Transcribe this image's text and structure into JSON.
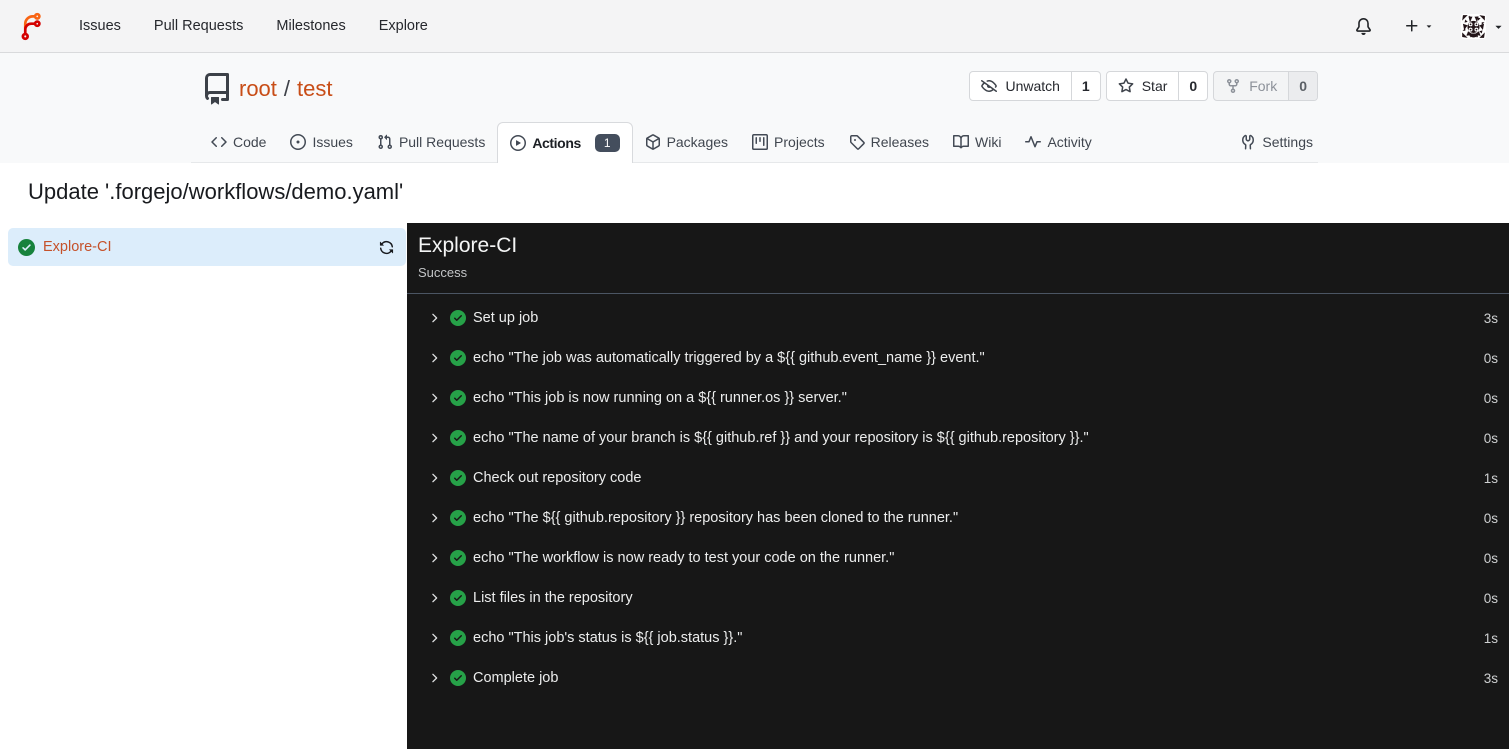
{
  "navbar": {
    "logo": "forgejo-logo",
    "links": [
      {
        "label": "Issues"
      },
      {
        "label": "Pull Requests"
      },
      {
        "label": "Milestones"
      },
      {
        "label": "Explore"
      }
    ],
    "icons": {
      "bell": "bell-icon",
      "plus": "plus-icon",
      "caret": "caret-down-icon",
      "avatar": "user-avatar-identicon"
    }
  },
  "repo_header": {
    "owner": "root",
    "separator": "/",
    "name": "test",
    "buttons": [
      {
        "label": "Unwatch",
        "count": "1",
        "icon": "eye-closed-icon",
        "disabled": false
      },
      {
        "label": "Star",
        "count": "0",
        "icon": "star-icon",
        "disabled": false
      },
      {
        "label": "Fork",
        "count": "0",
        "icon": "repo-forked-icon",
        "disabled": true
      }
    ],
    "tabs": [
      {
        "label": "Code",
        "icon": "code",
        "active": false
      },
      {
        "label": "Issues",
        "icon": "issue",
        "active": false
      },
      {
        "label": "Pull Requests",
        "icon": "pr",
        "active": false
      },
      {
        "label": "Actions",
        "icon": "play",
        "active": true,
        "badge": "1"
      },
      {
        "label": "Packages",
        "icon": "package",
        "active": false
      },
      {
        "label": "Projects",
        "icon": "project",
        "active": false
      },
      {
        "label": "Releases",
        "icon": "tag",
        "active": false
      },
      {
        "label": "Wiki",
        "icon": "book",
        "active": false
      },
      {
        "label": "Activity",
        "icon": "pulse",
        "active": false
      }
    ],
    "settings_tab": {
      "label": "Settings",
      "icon": "tools"
    }
  },
  "run": {
    "title": "Update '.forgejo/workflows/demo.yaml'",
    "jobs": [
      {
        "name": "Explore-CI",
        "status": "success"
      }
    ],
    "panel": {
      "job_name": "Explore-CI",
      "status_text": "Success",
      "steps": [
        {
          "name": "Set up job",
          "duration": "3s"
        },
        {
          "name": "echo \"The job was automatically triggered by a ${{ github.event_name }} event.\"",
          "duration": "0s"
        },
        {
          "name": "echo \"This job is now running on a ${{ runner.os }} server.\"",
          "duration": "0s"
        },
        {
          "name": "echo \"The name of your branch is ${{ github.ref }} and your repository is ${{ github.repository }}.\"",
          "duration": "0s"
        },
        {
          "name": "Check out repository code",
          "duration": "1s"
        },
        {
          "name": "echo \"The ${{ github.repository }} repository has been cloned to the runner.\"",
          "duration": "0s"
        },
        {
          "name": "echo \"The workflow is now ready to test your code on the runner.\"",
          "duration": "0s"
        },
        {
          "name": "List files in the repository",
          "duration": "0s"
        },
        {
          "name": "echo \"This job's status is ${{ job.status }}.\"",
          "duration": "1s"
        },
        {
          "name": "Complete job",
          "duration": "3s"
        }
      ]
    }
  },
  "colors": {
    "primary_orange": "#c84d17",
    "logo_orange": "#f86413",
    "logo_red": "#d40000",
    "success_green_dark_panel": "#26a148",
    "success_green_sidebar": "#17823c",
    "panel_background": "#171717",
    "job_selected_background": "#dcedfb",
    "badge_background": "#444e5d"
  }
}
